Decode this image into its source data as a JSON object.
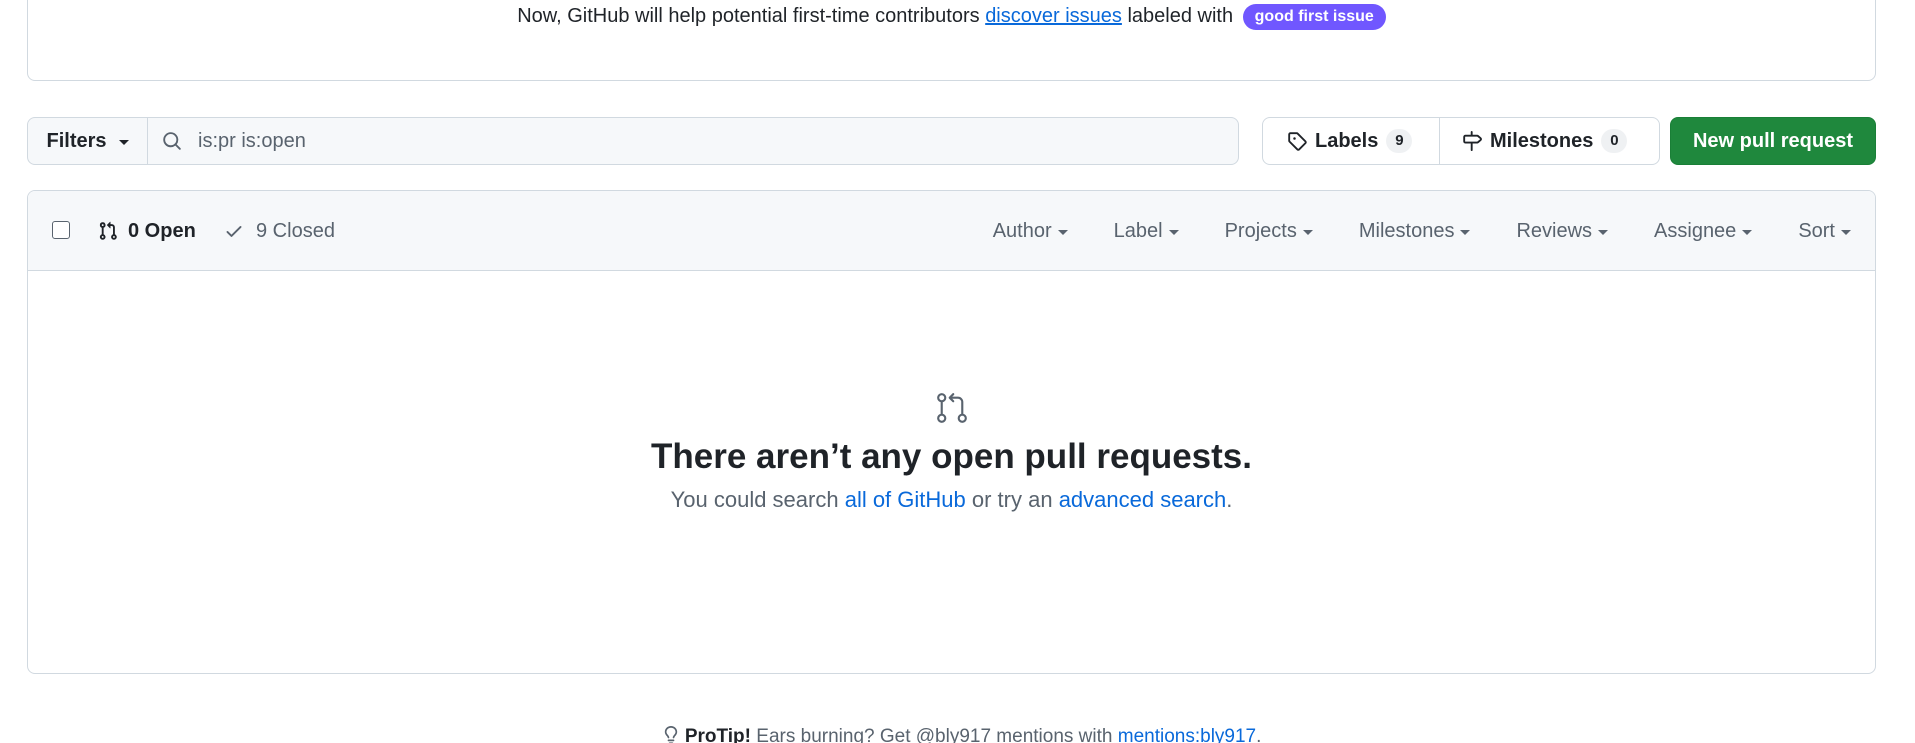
{
  "banner": {
    "text_before": "Now, GitHub will help potential first-time contributors ",
    "link": "discover issues",
    "text_after": " labeled with ",
    "label": "good first issue"
  },
  "filters": {
    "button_label": "Filters",
    "search_value": "is:pr is:open"
  },
  "labels_button": {
    "label": "Labels",
    "count": "9"
  },
  "milestones_button": {
    "label": "Milestones",
    "count": "0"
  },
  "new_pr_button": "New pull request",
  "list_header": {
    "open_label": "0 Open",
    "closed_label": "9 Closed",
    "menus": [
      "Author",
      "Label",
      "Projects",
      "Milestones",
      "Reviews",
      "Assignee",
      "Sort"
    ]
  },
  "blankslate": {
    "title": "There aren’t any open pull requests.",
    "text_before": "You could search ",
    "link1": "all of GitHub",
    "text_middle": " or try an ",
    "link2": "advanced search",
    "text_after": "."
  },
  "protip": {
    "label": "ProTip!",
    "text": " Ears burning? Get @bly917 mentions with ",
    "link": "mentions:bly917",
    "text_after": "."
  },
  "colors": {
    "accent": "#0969da",
    "primary_button": "#1f883d",
    "good_first_issue": "#7057ff"
  }
}
